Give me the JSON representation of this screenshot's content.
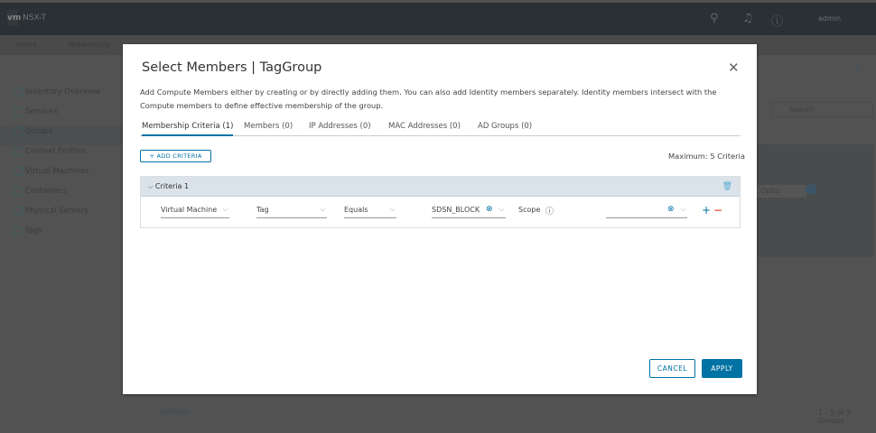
{
  "topbar": {
    "logo": "vm",
    "product": "NSX-T",
    "user": "admin"
  },
  "nav": {
    "items": [
      "Home",
      "Networking"
    ]
  },
  "sidebar": {
    "items": [
      "Inventory Overview",
      "Services",
      "Groups",
      "Context Profiles",
      "Virtual Machines",
      "Containers",
      "Physical Servers",
      "Tags"
    ],
    "active": "Groups"
  },
  "background": {
    "search_placeholder": "Search",
    "select_value": "Optio",
    "footer_refresh": "REFRESH",
    "footer_count": "1 - 5 of 5 Groups"
  },
  "modal": {
    "title": "Select Members | TagGroup",
    "description": "Add Compute Members either by creating or by directly adding them. You can also add Identity members separately. Identity members intersect with the Compute members to define effective membership of the group.",
    "tabs": [
      "Membership Criteria (1)",
      "Members (0)",
      "IP Addresses (0)",
      "MAC Addresses (0)",
      "AD Groups (0)"
    ],
    "add_criteria": "+ ADD CRITERIA",
    "maximum": "Maximum: 5 Criteria",
    "criteria": {
      "title": "Criteria 1",
      "member_type": "Virtual Machine",
      "attribute": "Tag",
      "operator": "Equals",
      "tag_value": "SDSN_BLOCK",
      "scope_label": "Scope",
      "scope_value": ""
    },
    "cancel": "CANCEL",
    "apply": "APPLY"
  },
  "colors": {
    "accent": "#0072a3",
    "remove": "#e12200"
  }
}
